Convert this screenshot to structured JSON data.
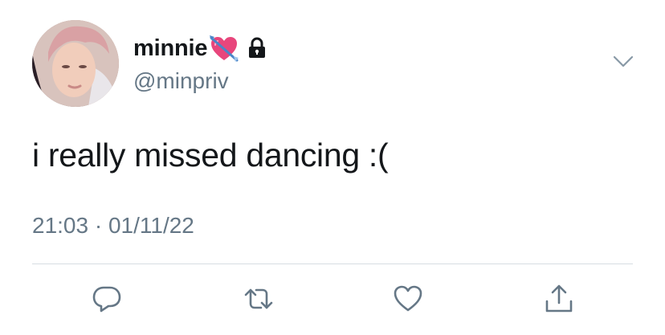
{
  "user": {
    "display_name": "minnie",
    "name_emoji": "heart-with-arrow",
    "protected_badge": "lock-icon",
    "handle": "@minpriv"
  },
  "tweet": {
    "text": "i really missed dancing :(",
    "time": "21:03",
    "separator": "·",
    "date": "01/11/22"
  },
  "actions": [
    {
      "name": "reply",
      "icon": "reply-icon"
    },
    {
      "name": "retweet",
      "icon": "retweet-icon"
    },
    {
      "name": "like",
      "icon": "heart-icon"
    },
    {
      "name": "share",
      "icon": "share-icon"
    }
  ],
  "colors": {
    "text_primary": "#14171a",
    "text_secondary": "#657786",
    "icon": "#657786",
    "divider": "#d7dde2",
    "emoji_heart": "#e8467c"
  }
}
